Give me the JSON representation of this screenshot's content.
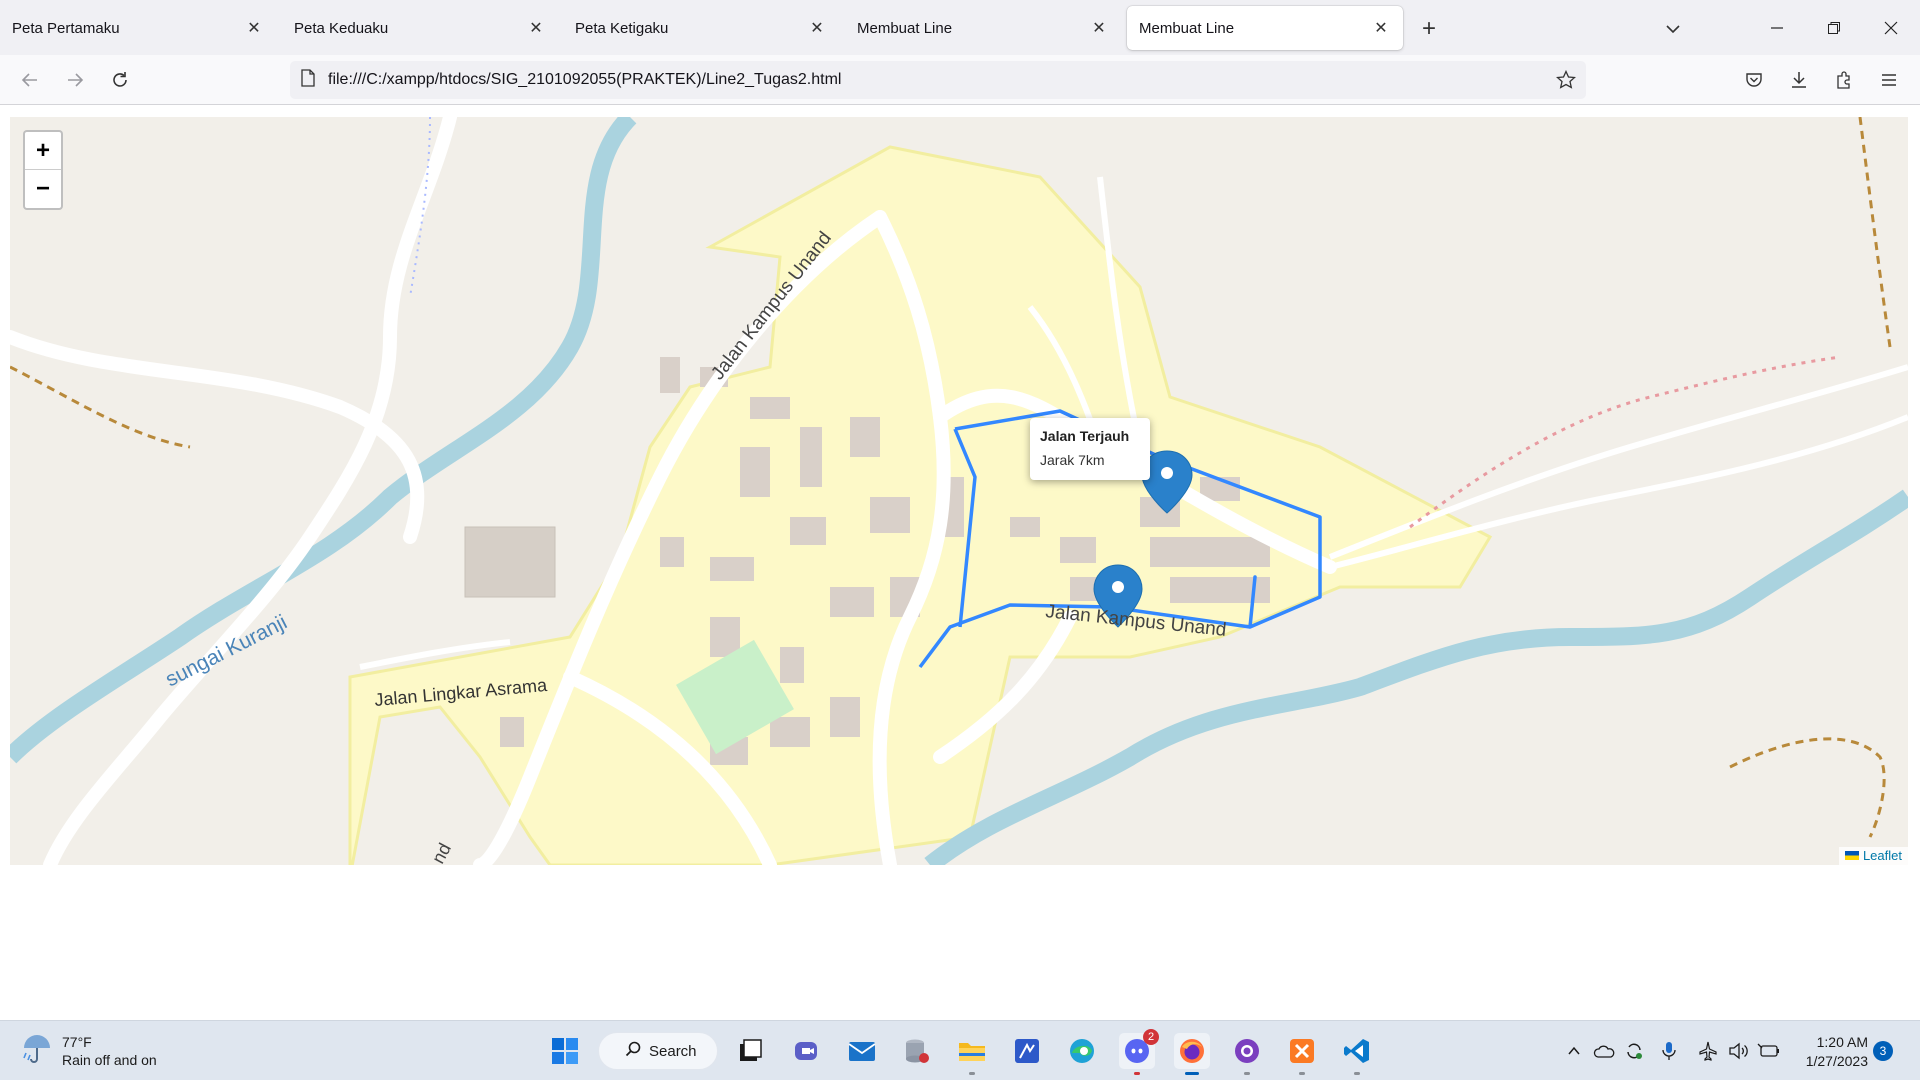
{
  "tabs": [
    {
      "label": "Peta Pertamaku",
      "active": false
    },
    {
      "label": "Peta Keduaku",
      "active": false
    },
    {
      "label": "Peta Ketigaku",
      "active": false
    },
    {
      "label": "Membuat Line",
      "active": false
    },
    {
      "label": "Membuat Line",
      "active": true
    }
  ],
  "url": "file:///C:/xampp/htdocs/SIG_2101092055(PRAKTEK)/Line2_Tugas2.html",
  "map": {
    "zoom_in": "+",
    "zoom_out": "−",
    "popup": {
      "title": "Jalan Terjauh",
      "body": "Jarak 7km"
    },
    "labels": {
      "road_top": "Jalan Kampus Unand",
      "road_route": "Jalan Kampus Unand",
      "road_asrama": "Jalan Lingkar Asrama",
      "river": "sungai Kuranji",
      "road_bottom": "nd"
    },
    "attribution": "Leaflet",
    "colors": {
      "land": "#f2efe9",
      "campus": "#fdf9c8",
      "river": "#aad3df",
      "route": "#3388ff",
      "marker": "#2a81cb"
    }
  },
  "taskbar": {
    "weather": {
      "temp": "77°F",
      "desc": "Rain off and on"
    },
    "search_label": "Search",
    "apps": [
      "windows-start-icon",
      "file-explorer-icon",
      "teams-icon",
      "mail-icon",
      "database-icon",
      "folder-icon",
      "pen-app-icon",
      "edge-icon",
      "discord-icon",
      "firefox-icon",
      "github-icon",
      "xampp-icon",
      "vscode-icon"
    ],
    "discord_badge": "2",
    "time": "1:20 AM",
    "date": "1/27/2023",
    "notifications": "3"
  }
}
